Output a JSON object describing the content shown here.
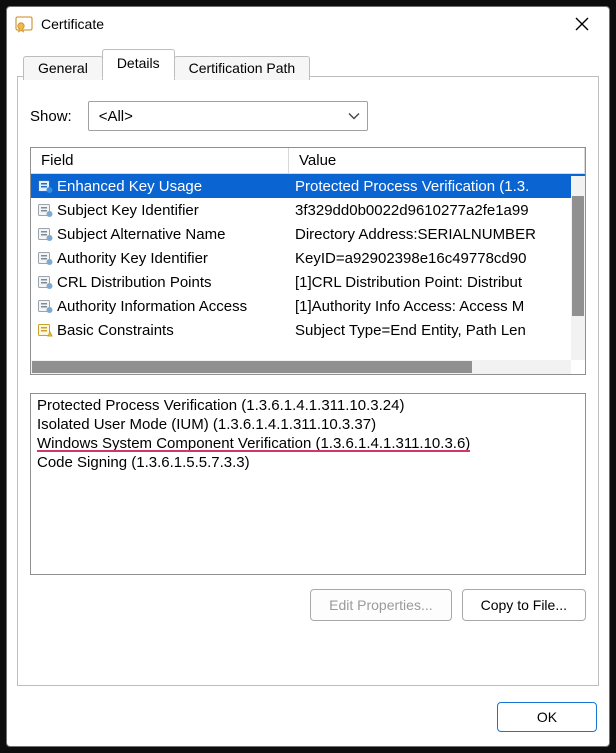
{
  "title": "Certificate",
  "tabs": [
    "General",
    "Details",
    "Certification Path"
  ],
  "show": {
    "label": "Show:",
    "value": "<All>"
  },
  "list": {
    "columns": [
      "Field",
      "Value"
    ],
    "rows": [
      {
        "field": "Enhanced Key Usage",
        "value": "Protected Process Verification (1.3.",
        "icon": "ext-blue",
        "selected": true
      },
      {
        "field": "Subject Key Identifier",
        "value": "3f329dd0b0022d9610277a2fe1a99",
        "icon": "ext",
        "selected": false
      },
      {
        "field": "Subject Alternative Name",
        "value": "Directory Address:SERIALNUMBER",
        "icon": "ext",
        "selected": false
      },
      {
        "field": "Authority Key Identifier",
        "value": "KeyID=a92902398e16c49778cd90",
        "icon": "ext",
        "selected": false
      },
      {
        "field": "CRL Distribution Points",
        "value": "[1]CRL Distribution Point: Distribut",
        "icon": "ext",
        "selected": false
      },
      {
        "field": "Authority Information Access",
        "value": "[1]Authority Info Access: Access M",
        "icon": "ext",
        "selected": false
      },
      {
        "field": "Basic Constraints",
        "value": "Subject Type=End Entity, Path Len",
        "icon": "ext-yellow",
        "selected": false
      }
    ]
  },
  "detail": {
    "lines": [
      "Protected Process Verification (1.3.6.1.4.1.311.10.3.24)",
      "Isolated User Mode (IUM) (1.3.6.1.4.1.311.10.3.37)",
      "Windows System Component Verification (1.3.6.1.4.1.311.10.3.6)",
      "Code Signing (1.3.6.1.5.5.7.3.3)"
    ]
  },
  "buttons": {
    "edit": "Edit Properties...",
    "copy": "Copy to File...",
    "ok": "OK"
  }
}
